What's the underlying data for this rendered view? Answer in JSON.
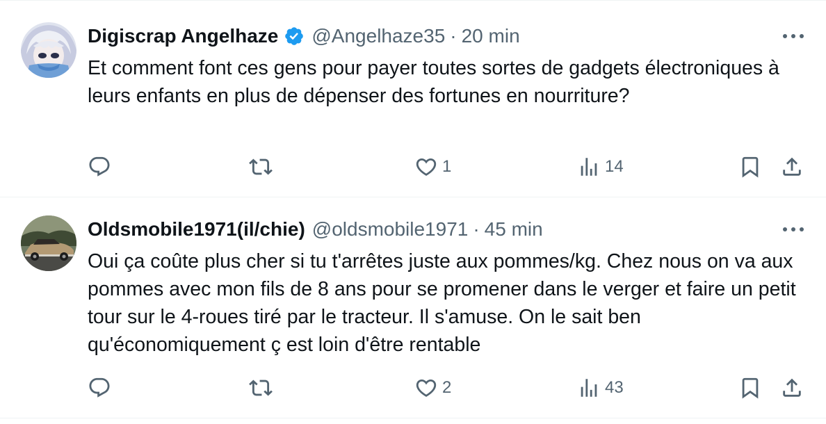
{
  "tweets": [
    {
      "name": "Digiscrap Angelhaze",
      "verified": true,
      "handle": "@Angelhaze35",
      "separator": "·",
      "time": "20 min",
      "text": "Et comment font ces gens pour payer toutes sortes de gadgets électroniques à leurs enfants en plus de dépenser des fortunes en nourriture?",
      "replies": "",
      "retweets": "",
      "likes": "1",
      "views": "14",
      "avatar_icon": "anime-avatar-icon"
    },
    {
      "name": "Oldsmobile1971(il/chie)",
      "verified": false,
      "handle": "@oldsmobile1971",
      "separator": "·",
      "time": "45 min",
      "text": "Oui ça coûte plus cher si tu t'arrêtes juste aux pommes/kg. Chez nous on va aux pommes avec mon fils de 8 ans pour se promener dans le verger et faire un petit tour sur le 4-roues tiré par le tracteur. Il s'amuse. On le sait ben qu'économiquement ç est loin d'être rentable",
      "replies": "",
      "retweets": "",
      "likes": "2",
      "views": "43",
      "avatar_icon": "vintage-car-avatar-icon"
    }
  ],
  "colors": {
    "text": "#0f1419",
    "secondary": "#536471",
    "verified_blue": "#1d9bf0",
    "divider": "#eff3f4"
  },
  "icons": [
    "reply-icon",
    "retweet-icon",
    "like-icon",
    "views-icon",
    "bookmark-icon",
    "share-icon",
    "more-icon",
    "verified-badge-icon"
  ]
}
